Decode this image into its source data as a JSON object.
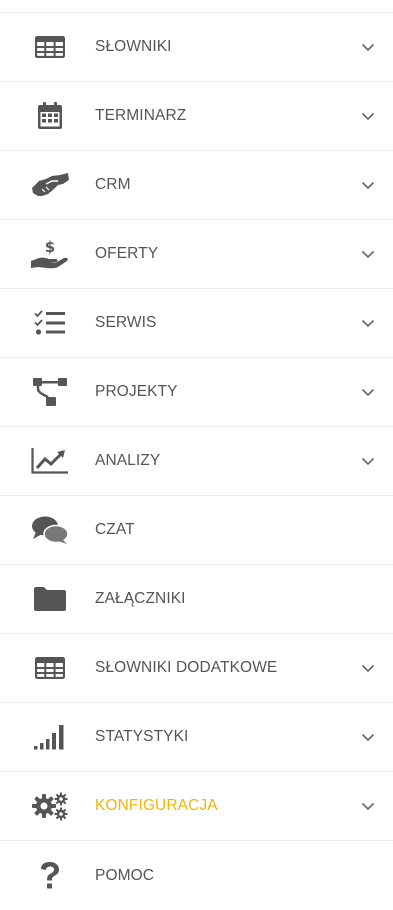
{
  "menu": {
    "items": [
      {
        "label": "SŁOWNIKI",
        "icon": "table-icon",
        "has_chevron": true
      },
      {
        "label": "TERMINARZ",
        "icon": "calendar-icon",
        "has_chevron": true
      },
      {
        "label": "CRM",
        "icon": "handshake-icon",
        "has_chevron": true
      },
      {
        "label": "OFERTY",
        "icon": "hand-money-icon",
        "has_chevron": true
      },
      {
        "label": "SERWIS",
        "icon": "checklist-icon",
        "has_chevron": true
      },
      {
        "label": "PROJEKTY",
        "icon": "sitemap-icon",
        "has_chevron": true
      },
      {
        "label": "ANALIZY",
        "icon": "line-chart-icon",
        "has_chevron": true
      },
      {
        "label": "CZAT",
        "icon": "chat-icon",
        "has_chevron": false
      },
      {
        "label": "ZAŁĄCZNIKI",
        "icon": "folder-icon",
        "has_chevron": false
      },
      {
        "label": "SŁOWNIKI DODATKOWE",
        "icon": "table-icon",
        "has_chevron": true
      },
      {
        "label": "STATYSTYKI",
        "icon": "signal-bars-icon",
        "has_chevron": true
      },
      {
        "label": "KONFIGURACJA",
        "icon": "gears-icon",
        "has_chevron": true,
        "active": true
      },
      {
        "label": "POMOC",
        "icon": "question-icon",
        "has_chevron": false
      }
    ]
  },
  "colors": {
    "icon": "#555555",
    "label": "#555555",
    "active_label": "#f4b400",
    "chevron": "#666666",
    "divider": "#ececec"
  }
}
